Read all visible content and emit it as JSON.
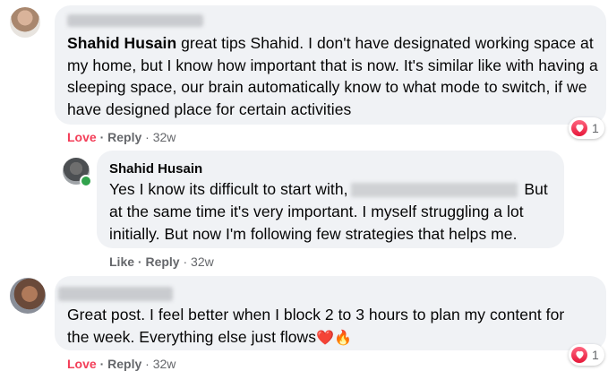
{
  "comments": [
    {
      "author": "Shahid Husain",
      "text_main": " great tips Shahid. I don't have designated working space at my home, but I know how important that is now. It's similar like with having a sleeping space, our brain automatically know to what mode to switch, if we have designed place for certain activities",
      "action_reaction": "Love",
      "action_reply": "Reply",
      "time": "32w",
      "reaction_count": "1",
      "reaction_icon": "heart-icon"
    },
    {
      "author": "Shahid Husain",
      "text_before": "Yes I know its difficult to start with,",
      "text_after": " But at the same time it's very important. I myself struggling a lot initially. But now I'm following few strategies that helps me.",
      "action_reaction": "Like",
      "action_reply": "Reply",
      "time": "32w"
    },
    {
      "text": "Great post. I feel better when I block 2 to 3 hours to plan my content for the week. Everything else just flows",
      "emojis": "❤️🔥",
      "action_reaction": "Love",
      "action_reply": "Reply",
      "time": "32w",
      "reaction_count": "1",
      "reaction_icon": "heart-icon"
    }
  ],
  "colors": {
    "bubble": "#f0f2f5",
    "love": "#f33e58",
    "meta": "#65676b",
    "online": "#31a24c"
  }
}
